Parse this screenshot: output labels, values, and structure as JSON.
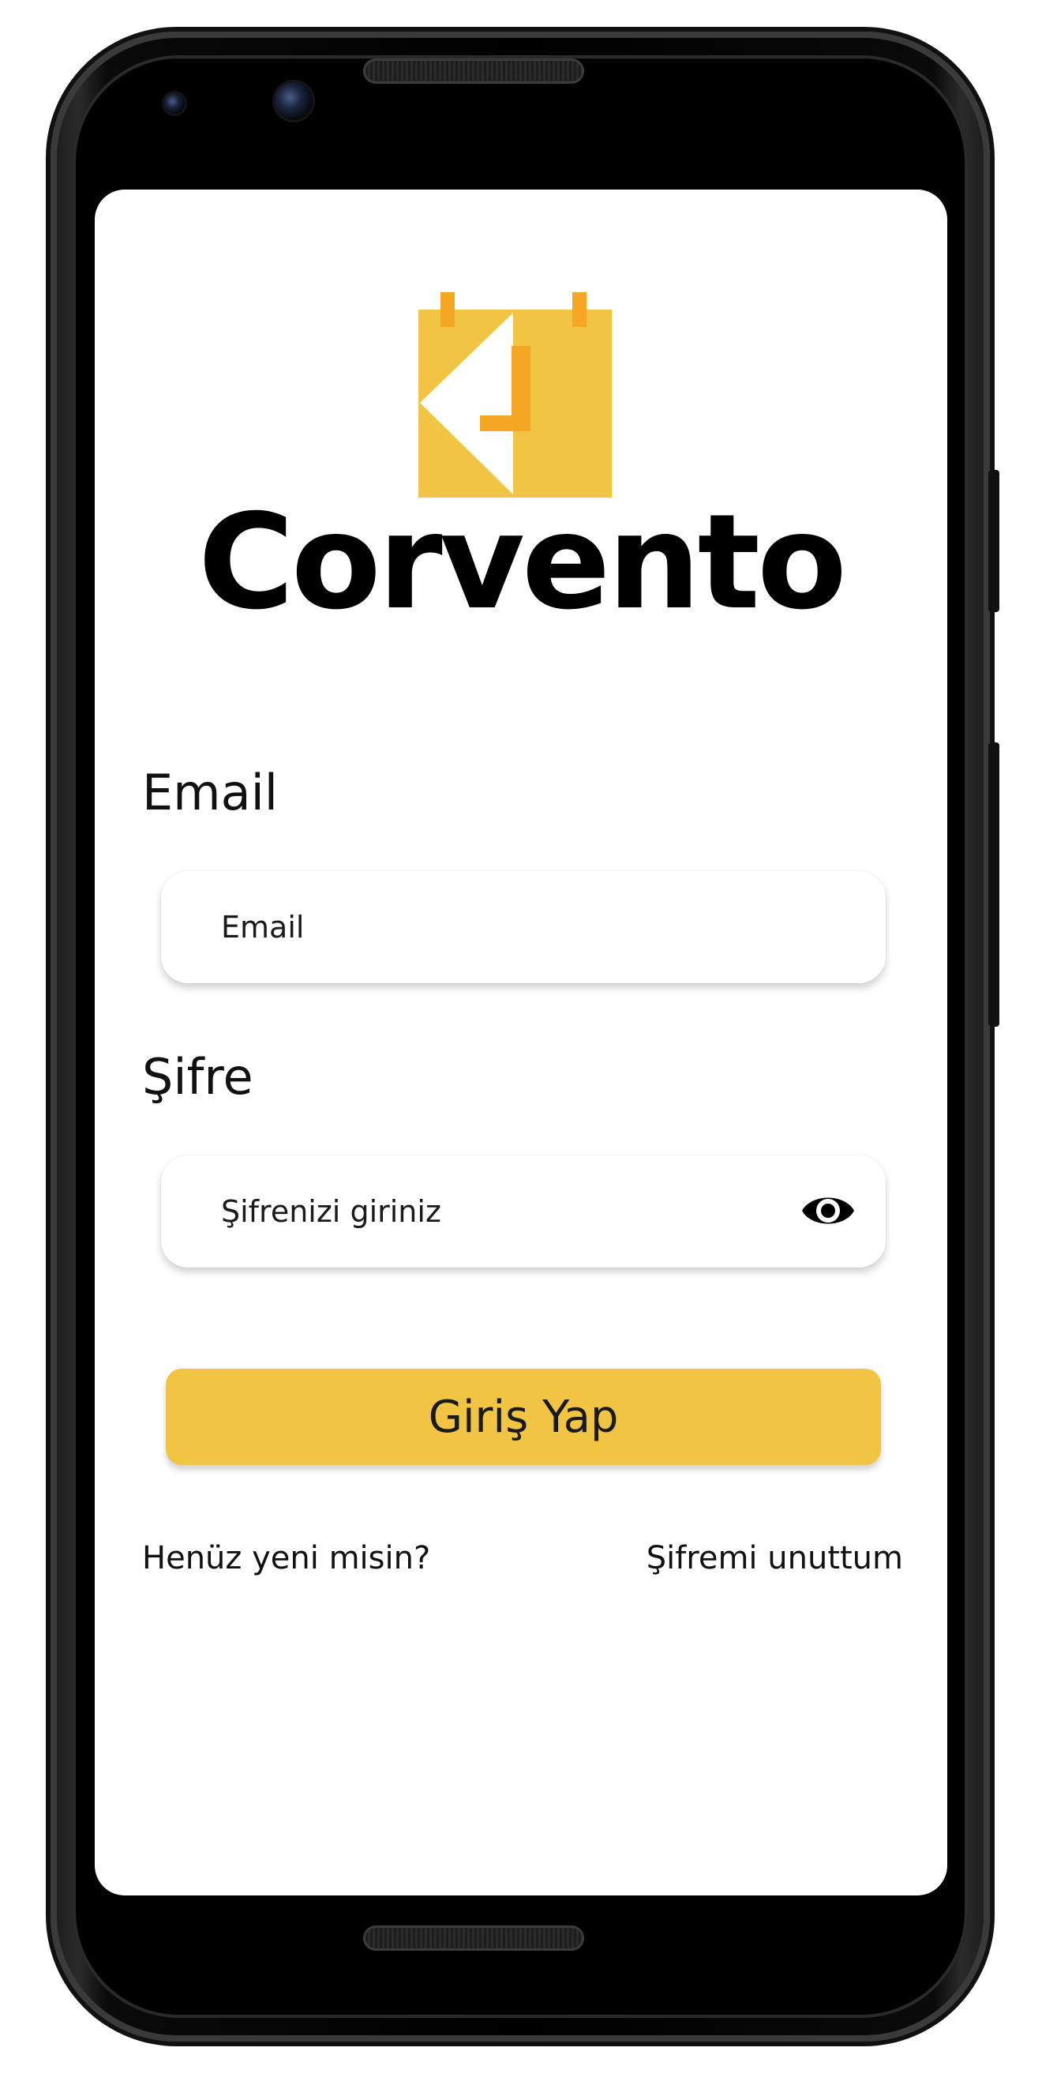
{
  "app": {
    "brand_name": "Corvento"
  },
  "login_form": {
    "email_label": "Email",
    "email_placeholder": "Email",
    "password_label": "Şifre",
    "password_placeholder": "Şifrenizi giriniz",
    "submit_label": "Giriş Yap"
  },
  "footer_links": {
    "signup_label": "Henüz yeni misin?",
    "forgot_password_label": "Şifremi unuttum"
  },
  "colors": {
    "accent": "#f2c443",
    "logo_tab": "#f5a623",
    "text": "#111111",
    "background": "#ffffff"
  },
  "icons": {
    "password_toggle": "eye-icon",
    "logo": "calendar-logo-icon"
  }
}
